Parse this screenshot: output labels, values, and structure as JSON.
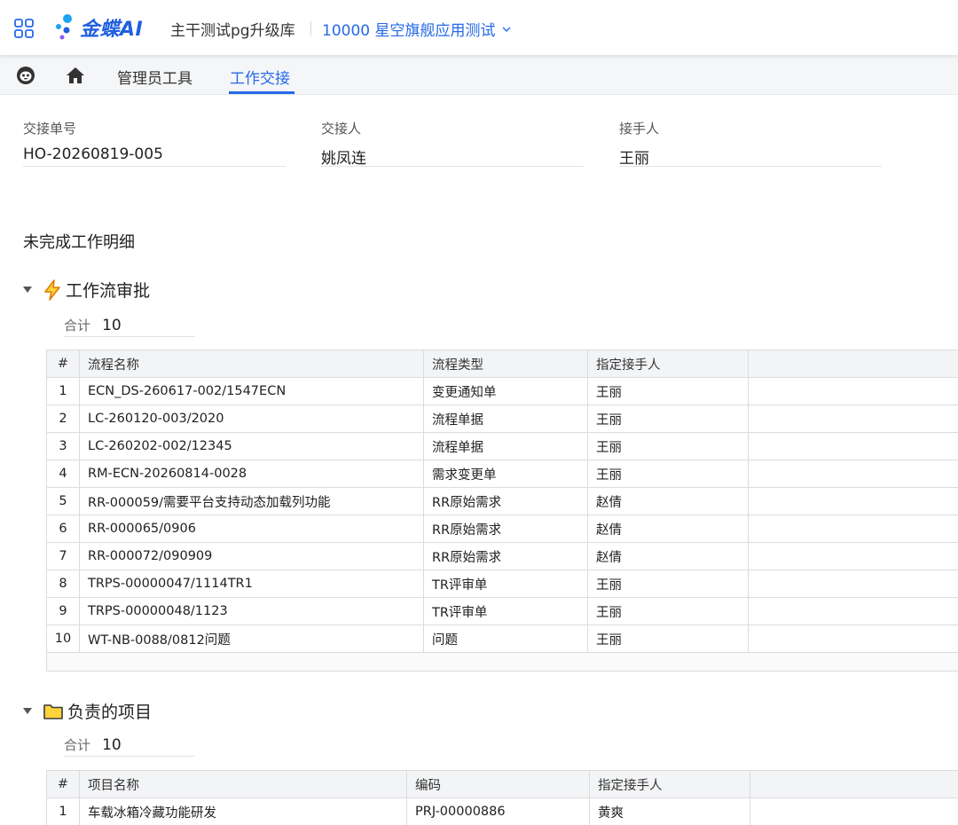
{
  "topbar": {
    "app_icon": "apps-grid-icon",
    "logo_text": "金蝶AI",
    "db_name": "主干测试pg升级库",
    "org_name": "10000 星空旗舰应用测试"
  },
  "tabs": [
    {
      "label": "管理员工具"
    },
    {
      "label": "工作交接"
    }
  ],
  "header_fields": {
    "handover_no": {
      "label": "交接单号",
      "value": "HO-20260819-005"
    },
    "from_person": {
      "label": "交接人",
      "value": "姚凤连"
    },
    "to_person": {
      "label": "接手人",
      "value": "王丽"
    }
  },
  "section_title": "未完成工作明细",
  "workflow": {
    "title": "工作流审批",
    "icon": "lightning-icon",
    "total_label": "合计",
    "total_value": "10",
    "columns": [
      "#",
      "流程名称",
      "流程类型",
      "指定接手人"
    ],
    "rows": [
      [
        "1",
        "ECN_DS-260617-002/1547ECN",
        "变更通知单",
        "王丽"
      ],
      [
        "2",
        "LC-260120-003/2020",
        "流程单据",
        "王丽"
      ],
      [
        "3",
        "LC-260202-002/12345",
        "流程单据",
        "王丽"
      ],
      [
        "4",
        "RM-ECN-20260814-0028",
        "需求变更单",
        "王丽"
      ],
      [
        "5",
        "RR-000059/需要平台支持动态加载列功能",
        "RR原始需求",
        "赵倩"
      ],
      [
        "6",
        "RR-000065/0906",
        "RR原始需求",
        "赵倩"
      ],
      [
        "7",
        "RR-000072/090909",
        "RR原始需求",
        "赵倩"
      ],
      [
        "8",
        "TRPS-00000047/1114TR1",
        "TR评审单",
        "王丽"
      ],
      [
        "9",
        "TRPS-00000048/1123",
        "TR评审单",
        "王丽"
      ],
      [
        "10",
        "WT-NB-0088/0812问题",
        "问题",
        "王丽"
      ]
    ]
  },
  "projects": {
    "title": "负责的项目",
    "icon": "folder-icon",
    "total_label": "合计",
    "total_value": "10",
    "columns": [
      "#",
      "项目名称",
      "编码",
      "指定接手人"
    ],
    "rows": [
      [
        "1",
        "车载冰箱冷藏功能研发",
        "PRJ-00000886",
        "黄爽"
      ]
    ]
  },
  "colors": {
    "accent": "#2669e8",
    "header_bg": "#f3f4f6"
  }
}
